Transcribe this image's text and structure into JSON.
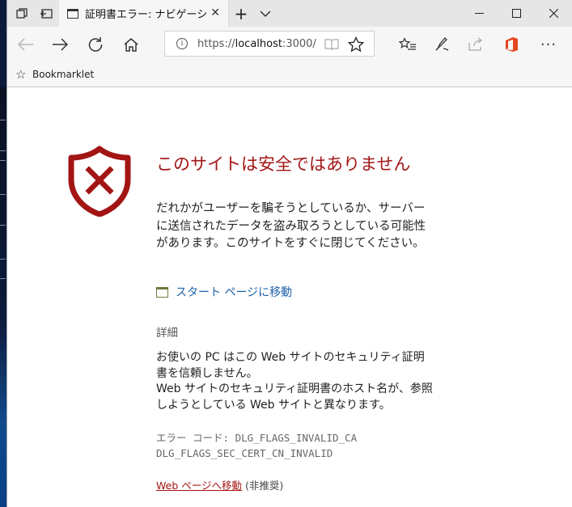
{
  "tab": {
    "title": "証明書エラー: ナビゲーション"
  },
  "address": {
    "scheme": "https://",
    "host": "localhost",
    "port_path": ":3000/"
  },
  "favorites": {
    "label": "Bookmarklet"
  },
  "content": {
    "title": "このサイトは安全ではありません",
    "description": "だれかがユーザーを騙そうとしているか、サーバーに送信されたデータを盗み取ろうとしている可能性があります。このサイトをすぐに閉じてください。",
    "start_link": "スタート ページに移動",
    "details_heading": "詳細",
    "details_line1": "お使いの PC はこの Web サイトのセキュリティ証明書を信頼しません。",
    "details_line2": "Web サイトのセキュリティ証明書のホスト名が、参照しようとしている Web サイトと異なります。",
    "error_code_label": "エラー コード:",
    "error_code_1": "DLG_FLAGS_INVALID_CA",
    "error_code_2": "DLG_FLAGS_SEC_CERT_CN_INVALID",
    "go_link": "Web ページへ移動",
    "go_note": "(非推奨)"
  },
  "colors": {
    "danger": "#a31515",
    "link": "#1e62a8"
  }
}
